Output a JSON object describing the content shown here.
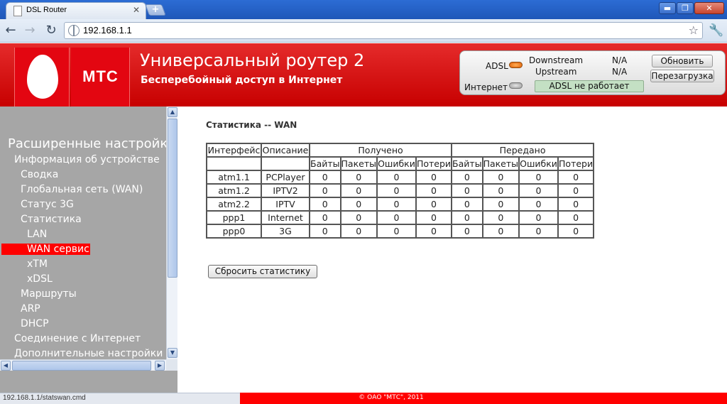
{
  "browser": {
    "tab_title": "DSL Router",
    "tab_close": "✕",
    "new_tab": "+",
    "win_min": "▬",
    "win_max": "❐",
    "win_close": "✕",
    "back": "←",
    "forward": "→",
    "reload": "↻",
    "url": "192.168.1.1",
    "star": "☆",
    "wrench": "🔧",
    "status_url": "192.168.1.1/statswan.cmd"
  },
  "header": {
    "logo_text": "МТС",
    "title": "Универсальный роутер 2",
    "subtitle": "Бесперебойный доступ в Интернет",
    "brand_color": "#e30611"
  },
  "status": {
    "adsl_label": "ADSL",
    "internet_label": "Интернет",
    "downstream_label": "Downstream",
    "upstream_label": "Upstream",
    "downstream_value": "N/A",
    "upstream_value": "N/A",
    "adsl_status": "ADSL не работает",
    "refresh_button": "Обновить",
    "reboot_button": "Перезагрузка"
  },
  "sidebar": {
    "items": [
      {
        "label": "Расширенные настройки",
        "level": 0
      },
      {
        "label": "Информация об устройстве",
        "level": 1
      },
      {
        "label": "Сводка",
        "level": 2
      },
      {
        "label": "Глобальная сеть (WAN)",
        "level": 2
      },
      {
        "label": "Статус 3G",
        "level": 2
      },
      {
        "label": "Статистика",
        "level": 2
      },
      {
        "label": "LAN",
        "level": 3
      },
      {
        "label": "WAN сервис",
        "level": 3,
        "active": true
      },
      {
        "label": "xTM",
        "level": 3
      },
      {
        "label": "xDSL",
        "level": 3
      },
      {
        "label": "Маршруты",
        "level": 2
      },
      {
        "label": "ARP",
        "level": 2
      },
      {
        "label": "DHCP",
        "level": 2
      },
      {
        "label": "Соединение с Интернет",
        "level": 1
      },
      {
        "label": "Дополнительные настройки",
        "level": 1
      }
    ]
  },
  "main": {
    "heading": "Статистика -- WAN",
    "table": {
      "col_interface": "Интерфейс",
      "col_description": "Описание",
      "group_received": "Получено",
      "group_transmitted": "Передано",
      "sub_headers": [
        "Байты",
        "Пакеты",
        "Ошибки",
        "Потери",
        "Байты",
        "Пакеты",
        "Ошибки",
        "Потери"
      ],
      "rows": [
        {
          "interface": "atm1.1",
          "description": "PCPlayer",
          "values": [
            "0",
            "0",
            "0",
            "0",
            "0",
            "0",
            "0",
            "0"
          ]
        },
        {
          "interface": "atm1.2",
          "description": "IPTV2",
          "values": [
            "0",
            "0",
            "0",
            "0",
            "0",
            "0",
            "0",
            "0"
          ]
        },
        {
          "interface": "atm2.2",
          "description": "IPTV",
          "values": [
            "0",
            "0",
            "0",
            "0",
            "0",
            "0",
            "0",
            "0"
          ]
        },
        {
          "interface": "ppp1",
          "description": "Internet",
          "values": [
            "0",
            "0",
            "0",
            "0",
            "0",
            "0",
            "0",
            "0"
          ]
        },
        {
          "interface": "ppp0",
          "description": "3G",
          "values": [
            "0",
            "0",
            "0",
            "0",
            "0",
            "0",
            "0",
            "0"
          ]
        }
      ]
    },
    "reset_button": "Сбросить статистику"
  },
  "footer": {
    "copyright": "© ОАО \"МТС\", 2011"
  }
}
